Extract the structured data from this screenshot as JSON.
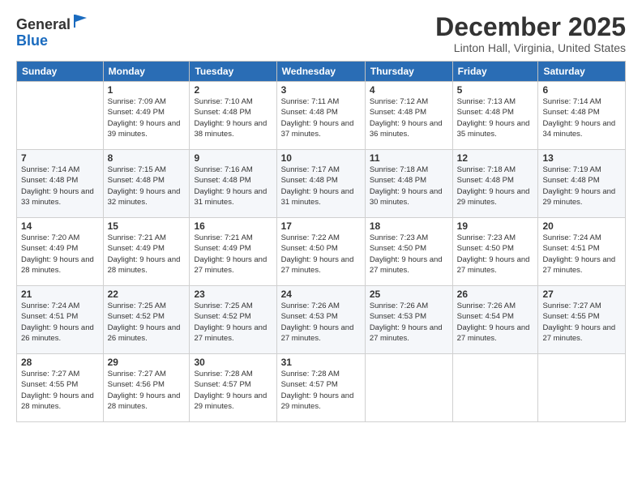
{
  "logo": {
    "general": "General",
    "blue": "Blue"
  },
  "header": {
    "month": "December 2025",
    "location": "Linton Hall, Virginia, United States"
  },
  "days_of_week": [
    "Sunday",
    "Monday",
    "Tuesday",
    "Wednesday",
    "Thursday",
    "Friday",
    "Saturday"
  ],
  "weeks": [
    [
      {
        "day": "",
        "sunrise": "",
        "sunset": "",
        "daylight": ""
      },
      {
        "day": "1",
        "sunrise": "Sunrise: 7:09 AM",
        "sunset": "Sunset: 4:49 PM",
        "daylight": "Daylight: 9 hours and 39 minutes."
      },
      {
        "day": "2",
        "sunrise": "Sunrise: 7:10 AM",
        "sunset": "Sunset: 4:48 PM",
        "daylight": "Daylight: 9 hours and 38 minutes."
      },
      {
        "day": "3",
        "sunrise": "Sunrise: 7:11 AM",
        "sunset": "Sunset: 4:48 PM",
        "daylight": "Daylight: 9 hours and 37 minutes."
      },
      {
        "day": "4",
        "sunrise": "Sunrise: 7:12 AM",
        "sunset": "Sunset: 4:48 PM",
        "daylight": "Daylight: 9 hours and 36 minutes."
      },
      {
        "day": "5",
        "sunrise": "Sunrise: 7:13 AM",
        "sunset": "Sunset: 4:48 PM",
        "daylight": "Daylight: 9 hours and 35 minutes."
      },
      {
        "day": "6",
        "sunrise": "Sunrise: 7:14 AM",
        "sunset": "Sunset: 4:48 PM",
        "daylight": "Daylight: 9 hours and 34 minutes."
      }
    ],
    [
      {
        "day": "7",
        "sunrise": "Sunrise: 7:14 AM",
        "sunset": "Sunset: 4:48 PM",
        "daylight": "Daylight: 9 hours and 33 minutes."
      },
      {
        "day": "8",
        "sunrise": "Sunrise: 7:15 AM",
        "sunset": "Sunset: 4:48 PM",
        "daylight": "Daylight: 9 hours and 32 minutes."
      },
      {
        "day": "9",
        "sunrise": "Sunrise: 7:16 AM",
        "sunset": "Sunset: 4:48 PM",
        "daylight": "Daylight: 9 hours and 31 minutes."
      },
      {
        "day": "10",
        "sunrise": "Sunrise: 7:17 AM",
        "sunset": "Sunset: 4:48 PM",
        "daylight": "Daylight: 9 hours and 31 minutes."
      },
      {
        "day": "11",
        "sunrise": "Sunrise: 7:18 AM",
        "sunset": "Sunset: 4:48 PM",
        "daylight": "Daylight: 9 hours and 30 minutes."
      },
      {
        "day": "12",
        "sunrise": "Sunrise: 7:18 AM",
        "sunset": "Sunset: 4:48 PM",
        "daylight": "Daylight: 9 hours and 29 minutes."
      },
      {
        "day": "13",
        "sunrise": "Sunrise: 7:19 AM",
        "sunset": "Sunset: 4:48 PM",
        "daylight": "Daylight: 9 hours and 29 minutes."
      }
    ],
    [
      {
        "day": "14",
        "sunrise": "Sunrise: 7:20 AM",
        "sunset": "Sunset: 4:49 PM",
        "daylight": "Daylight: 9 hours and 28 minutes."
      },
      {
        "day": "15",
        "sunrise": "Sunrise: 7:21 AM",
        "sunset": "Sunset: 4:49 PM",
        "daylight": "Daylight: 9 hours and 28 minutes."
      },
      {
        "day": "16",
        "sunrise": "Sunrise: 7:21 AM",
        "sunset": "Sunset: 4:49 PM",
        "daylight": "Daylight: 9 hours and 27 minutes."
      },
      {
        "day": "17",
        "sunrise": "Sunrise: 7:22 AM",
        "sunset": "Sunset: 4:50 PM",
        "daylight": "Daylight: 9 hours and 27 minutes."
      },
      {
        "day": "18",
        "sunrise": "Sunrise: 7:23 AM",
        "sunset": "Sunset: 4:50 PM",
        "daylight": "Daylight: 9 hours and 27 minutes."
      },
      {
        "day": "19",
        "sunrise": "Sunrise: 7:23 AM",
        "sunset": "Sunset: 4:50 PM",
        "daylight": "Daylight: 9 hours and 27 minutes."
      },
      {
        "day": "20",
        "sunrise": "Sunrise: 7:24 AM",
        "sunset": "Sunset: 4:51 PM",
        "daylight": "Daylight: 9 hours and 27 minutes."
      }
    ],
    [
      {
        "day": "21",
        "sunrise": "Sunrise: 7:24 AM",
        "sunset": "Sunset: 4:51 PM",
        "daylight": "Daylight: 9 hours and 26 minutes."
      },
      {
        "day": "22",
        "sunrise": "Sunrise: 7:25 AM",
        "sunset": "Sunset: 4:52 PM",
        "daylight": "Daylight: 9 hours and 26 minutes."
      },
      {
        "day": "23",
        "sunrise": "Sunrise: 7:25 AM",
        "sunset": "Sunset: 4:52 PM",
        "daylight": "Daylight: 9 hours and 27 minutes."
      },
      {
        "day": "24",
        "sunrise": "Sunrise: 7:26 AM",
        "sunset": "Sunset: 4:53 PM",
        "daylight": "Daylight: 9 hours and 27 minutes."
      },
      {
        "day": "25",
        "sunrise": "Sunrise: 7:26 AM",
        "sunset": "Sunset: 4:53 PM",
        "daylight": "Daylight: 9 hours and 27 minutes."
      },
      {
        "day": "26",
        "sunrise": "Sunrise: 7:26 AM",
        "sunset": "Sunset: 4:54 PM",
        "daylight": "Daylight: 9 hours and 27 minutes."
      },
      {
        "day": "27",
        "sunrise": "Sunrise: 7:27 AM",
        "sunset": "Sunset: 4:55 PM",
        "daylight": "Daylight: 9 hours and 27 minutes."
      }
    ],
    [
      {
        "day": "28",
        "sunrise": "Sunrise: 7:27 AM",
        "sunset": "Sunset: 4:55 PM",
        "daylight": "Daylight: 9 hours and 28 minutes."
      },
      {
        "day": "29",
        "sunrise": "Sunrise: 7:27 AM",
        "sunset": "Sunset: 4:56 PM",
        "daylight": "Daylight: 9 hours and 28 minutes."
      },
      {
        "day": "30",
        "sunrise": "Sunrise: 7:28 AM",
        "sunset": "Sunset: 4:57 PM",
        "daylight": "Daylight: 9 hours and 29 minutes."
      },
      {
        "day": "31",
        "sunrise": "Sunrise: 7:28 AM",
        "sunset": "Sunset: 4:57 PM",
        "daylight": "Daylight: 9 hours and 29 minutes."
      },
      {
        "day": "",
        "sunrise": "",
        "sunset": "",
        "daylight": ""
      },
      {
        "day": "",
        "sunrise": "",
        "sunset": "",
        "daylight": ""
      },
      {
        "day": "",
        "sunrise": "",
        "sunset": "",
        "daylight": ""
      }
    ]
  ]
}
